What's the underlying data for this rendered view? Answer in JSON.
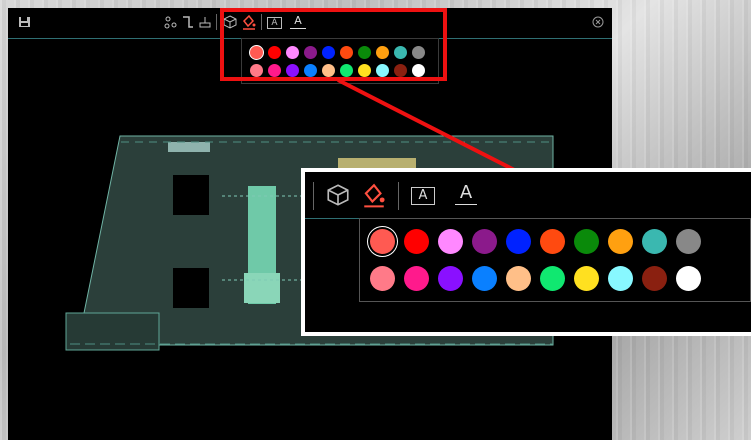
{
  "toolbar": {
    "icons": [
      "save-icon",
      "measure-icon",
      "section-icon",
      "floor-icon",
      "cube-icon",
      "paint-bucket-icon",
      "text-box-icon",
      "text-icon",
      "close-icon"
    ],
    "text_box_label": "A",
    "text_label": "A",
    "accent_color": "#2f9aa0",
    "active_tool_color": "#ff5040"
  },
  "palette": {
    "selected_index": 0,
    "row1": [
      "#ff5a52",
      "#ff0000",
      "#ff88ff",
      "#8b1a8b",
      "#0022ff",
      "#ff4a10",
      "#0a8a0a",
      "#ffa010",
      "#3ab8b0",
      "#888888"
    ],
    "row2": [
      "#ff7a88",
      "#ff1a8c",
      "#8a10ff",
      "#0a80ff",
      "#ffbf88",
      "#10e870",
      "#ffe020",
      "#88f8ff",
      "#8a2010",
      "#ffffff"
    ]
  },
  "annotation": {
    "color": "#e11111"
  }
}
